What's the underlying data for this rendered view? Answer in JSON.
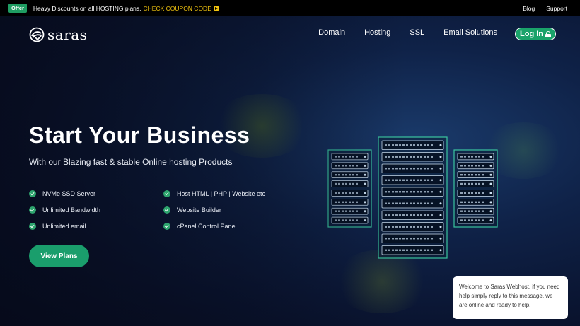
{
  "topbar": {
    "offer_badge": "Offer",
    "offer_text": "Heavy Discounts on all HOSTING plans.",
    "offer_link": "CHECK COUPON CODE",
    "right_links": [
      "Blog",
      "Support"
    ]
  },
  "nav": {
    "logo_text": "saras",
    "links": [
      "Domain",
      "Hosting",
      "SSL",
      "Email Solutions"
    ],
    "login_label": "Log In"
  },
  "hero": {
    "title": "Start Your Business",
    "subtitle": "With our Blazing fast & stable Online hosting Products",
    "features_left": [
      "NVMe SSD Server",
      "Unlimited Bandwidth",
      "Unlimited email"
    ],
    "features_right": [
      "Host HTML | PHP | Website etc",
      "Website Builder",
      "cPanel Control Panel"
    ],
    "cta_label": "View Plans"
  },
  "chat": {
    "message": "Welcome to Saras Webhost, if you need help simply reply to this message, we are online and ready to help."
  },
  "colors": {
    "accent": "#1a9e6c",
    "badge": "#1f9d62",
    "link_yellow": "#f1c40f",
    "server_glow": "#3fd6a8"
  }
}
